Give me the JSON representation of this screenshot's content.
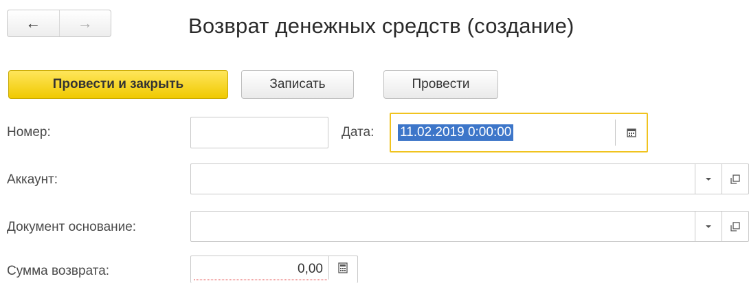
{
  "nav": {
    "back_icon": "←",
    "forward_icon": "→"
  },
  "title": "Возврат денежных средств (создание)",
  "toolbar": {
    "post_and_close_label": "Провести и закрыть",
    "save_label": "Записать",
    "post_label": "Провести"
  },
  "fields": {
    "number_label": "Номер:",
    "number_value": "",
    "date_label": "Дата:",
    "date_value": "11.02.2019  0:00:00",
    "account_label": "Аккаунт:",
    "account_value": "",
    "base_doc_label": "Документ основание:",
    "base_doc_value": "",
    "refund_sum_label": "Сумма возврата:",
    "refund_sum_value": "0,00"
  },
  "colors": {
    "accent": "#f0c900",
    "selection": "#3d76c9",
    "date_focus": "#f0c31f"
  }
}
